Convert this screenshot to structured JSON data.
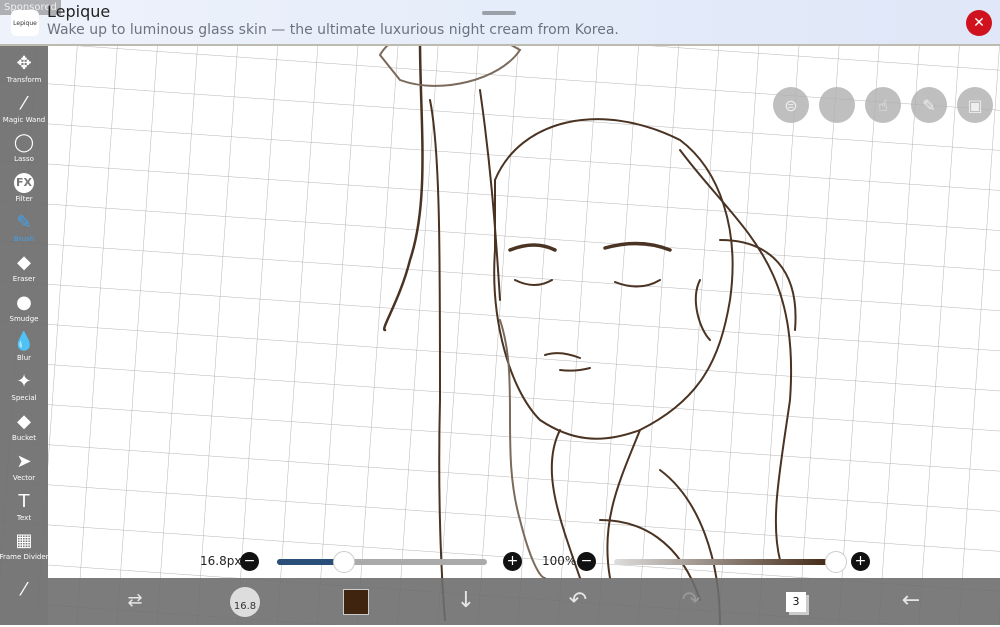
{
  "ad": {
    "sponsored": "Sponsored",
    "logo_text": "Lepique",
    "title": "Lepique",
    "description": "Wake up to luminous glass skin — the ultimate luxurious night cream from Korea."
  },
  "tools": [
    {
      "label": "Transform",
      "icon": "✥"
    },
    {
      "label": "Magic Wand",
      "icon": "⁄"
    },
    {
      "label": "Lasso",
      "icon": "◯"
    },
    {
      "label": "Filter",
      "icon": "FX"
    },
    {
      "label": "Brush",
      "icon": "✎"
    },
    {
      "label": "Eraser",
      "icon": "◆"
    },
    {
      "label": "Smudge",
      "icon": "●"
    },
    {
      "label": "Blur",
      "icon": "💧"
    },
    {
      "label": "Special",
      "icon": "✦"
    },
    {
      "label": "Bucket",
      "icon": "◆"
    },
    {
      "label": "Vector",
      "icon": "➤"
    },
    {
      "label": "Text",
      "icon": "T"
    },
    {
      "label": "Frame Divider",
      "icon": "▦"
    },
    {
      "label": "",
      "icon": "⁄"
    }
  ],
  "active_tool": "Brush",
  "brush": {
    "size_label": "16.8px",
    "size_fraction": 0.32,
    "opacity_label": "100%",
    "opacity_fraction": 1.0,
    "indicator": "16.8"
  },
  "colors": {
    "current": "#3f2410",
    "accent": "#3fa3f0",
    "size_track": "#2a4f78"
  },
  "layers": {
    "count": "3"
  }
}
